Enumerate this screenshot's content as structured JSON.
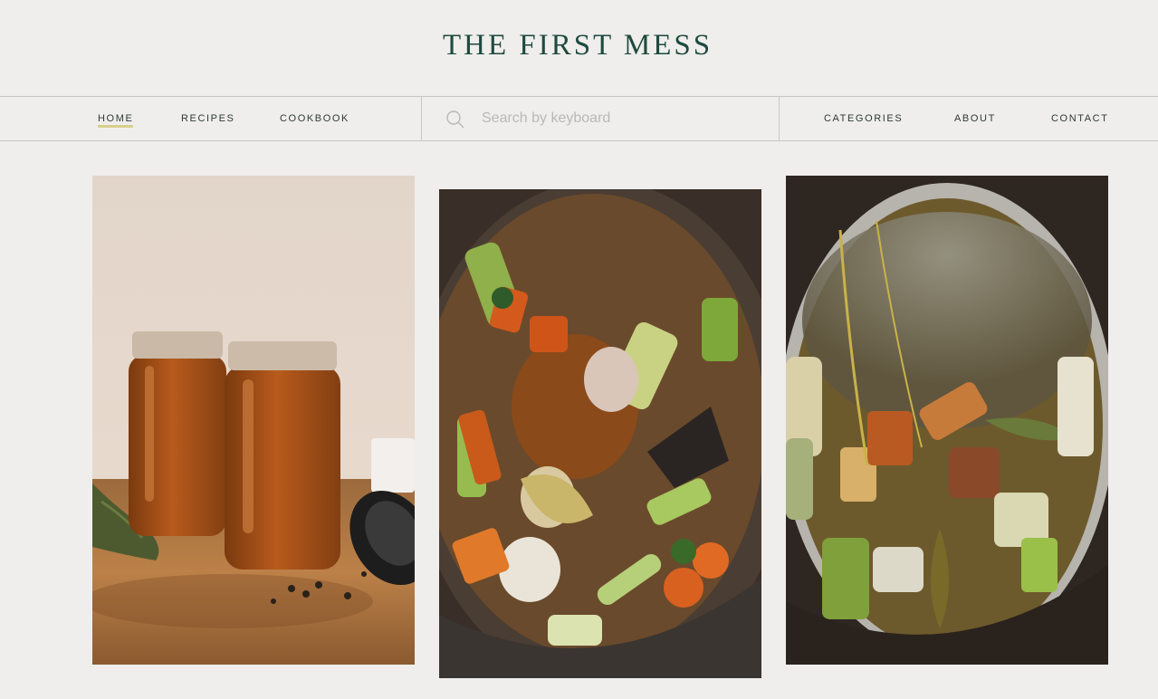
{
  "site": {
    "title": "THE FIRST MESS"
  },
  "nav": {
    "left": [
      {
        "label": "HOME",
        "active": true
      },
      {
        "label": "RECIPES",
        "active": false
      },
      {
        "label": "COOKBOOK",
        "active": false
      }
    ],
    "right": [
      {
        "label": "CATEGORIES"
      },
      {
        "label": "ABOUT"
      },
      {
        "label": "CONTACT"
      }
    ],
    "search": {
      "placeholder": "Search by keyboard",
      "icon": "search-icon"
    },
    "accent_underline": "#d8cf8c"
  },
  "colors": {
    "background": "#efeeec",
    "brand": "#1e4a40",
    "border": "#c9c7c3"
  },
  "feed": [
    {
      "name": "broth-jars-photo",
      "icon": "photo"
    },
    {
      "name": "vegetable-pot-photo",
      "icon": "photo"
    },
    {
      "name": "simmering-broth-photo",
      "icon": "photo"
    }
  ]
}
